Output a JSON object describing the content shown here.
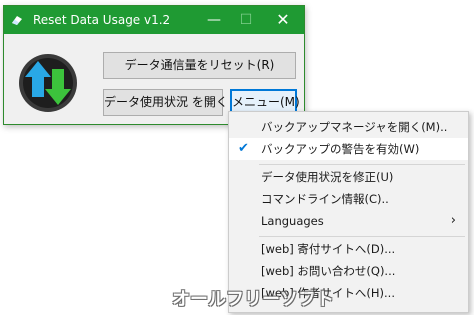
{
  "window": {
    "title": "Reset Data Usage v1.2",
    "icon": "eraser-icon",
    "controls": {
      "minimize": "—",
      "maximize": "☐",
      "close": "✕"
    },
    "accent_color": "#1f9a33"
  },
  "buttons": {
    "reset_label": "データ通信量をリセット(R)",
    "open_label": "データ使用状況 を開く",
    "menu_label": "メニュー(M)"
  },
  "menu": {
    "items": [
      {
        "label": "バックアップマネージャを開く(M)..",
        "checked": false
      },
      {
        "label": "バックアップの警告を有効(W)",
        "checked": true
      },
      {
        "label": "データ使用状況を修正(U)",
        "checked": false
      },
      {
        "label": "コマンドライン情報(C)..",
        "checked": false
      },
      {
        "label": "Languages",
        "submenu": true
      },
      {
        "label": "[web] 寄付サイトへ(D)...",
        "checked": false
      },
      {
        "label": "[web] お問い合わせ(Q)...",
        "checked": false
      },
      {
        "label": "[web] 作者サイトへ(H)...",
        "checked": false
      }
    ],
    "check_glyph": "✔",
    "submenu_glyph": "›"
  },
  "watermark": "オールフリーソフト"
}
